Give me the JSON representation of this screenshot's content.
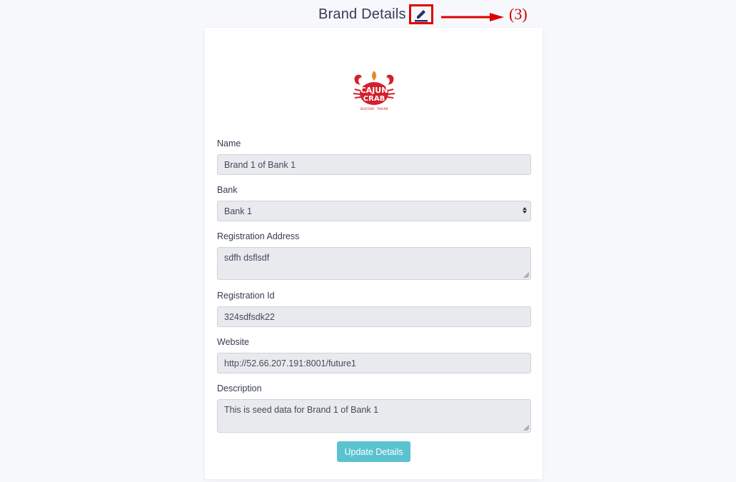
{
  "header": {
    "title": "Brand Details",
    "annotation": "(3)"
  },
  "logo": {
    "line1": "CAJUN",
    "line2": "CRAB",
    "tagline": "SEAFOOD · TAVERN",
    "brand_color": "#d4202a"
  },
  "form": {
    "name_label": "Name",
    "name_value": "Brand 1 of Bank 1",
    "bank_label": "Bank",
    "bank_value": "Bank 1",
    "address_label": "Registration Address",
    "address_value": "sdfh dsflsdf",
    "regid_label": "Registration Id",
    "regid_value": "324sdfsdk22",
    "website_label": "Website",
    "website_value": "http://52.66.207.191:8001/future1",
    "description_label": "Description",
    "description_value": "This is seed data for Brand 1 of Bank 1",
    "submit_label": "Update Details"
  },
  "colors": {
    "accent": "#5bc2d0",
    "annotation": "#e00000",
    "icon": "#2b2f6b"
  }
}
